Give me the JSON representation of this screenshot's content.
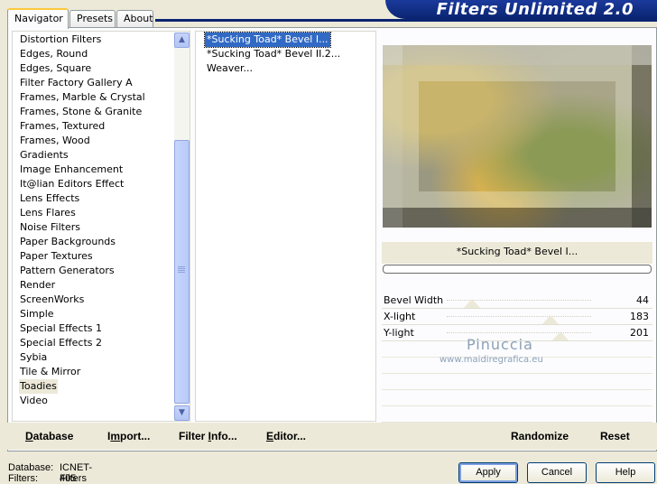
{
  "header": {
    "title": "Filters Unlimited 2.0"
  },
  "tabs": [
    {
      "label": "Navigator",
      "active": true
    },
    {
      "label": "Presets",
      "active": false
    },
    {
      "label": "About",
      "active": false
    }
  ],
  "categories": [
    "Distortion Filters",
    "Edges, Round",
    "Edges, Square",
    "Filter Factory Gallery A",
    "Frames, Marble & Crystal",
    "Frames, Stone & Granite",
    "Frames, Textured",
    "Frames, Wood",
    "Gradients",
    "Image Enhancement",
    "It@lian Editors Effect",
    "Lens Effects",
    "Lens Flares",
    "Noise Filters",
    "Paper Backgrounds",
    "Paper Textures",
    "Pattern Generators",
    "Render",
    "ScreenWorks",
    "Simple",
    "Special Effects 1",
    "Special Effects 2",
    "Sybia",
    "Tile & Mirror",
    "Toadies",
    "Video"
  ],
  "selected_category": "Toadies",
  "filters": [
    {
      "label": "*Sucking Toad*  Bevel I...",
      "selected": true
    },
    {
      "label": "*Sucking Toad*  Bevel II.2...",
      "selected": false
    },
    {
      "label": "Weaver...",
      "selected": false
    }
  ],
  "preview": {
    "filter_name": "*Sucking Toad*  Bevel I..."
  },
  "params": [
    {
      "label": "Bevel Width",
      "value": "44",
      "fraction": 0.173
    },
    {
      "label": "X-light",
      "value": "183",
      "fraction": 0.718
    },
    {
      "label": "Y-light",
      "value": "201",
      "fraction": 0.788
    }
  ],
  "watermark": {
    "line1": "Pinuccia",
    "line2": "www.maidiregrafica.eu"
  },
  "toolbar": {
    "database": {
      "accel": "D",
      "rest": "atabase"
    },
    "import": {
      "pre": "I",
      "accel": "m",
      "rest": "port..."
    },
    "filter_info": {
      "pre": "Filter ",
      "accel": "I",
      "rest": "nfo..."
    },
    "editor": {
      "accel": "E",
      "rest": "ditor..."
    },
    "randomize": "Randomize",
    "reset": "Reset"
  },
  "status": {
    "database_label": "Database:",
    "database_value": "ICNET-Filters",
    "filters_label": "Filters:",
    "filters_value": "405"
  },
  "buttons": {
    "apply": "Apply",
    "cancel": "Cancel",
    "help": "Help"
  }
}
